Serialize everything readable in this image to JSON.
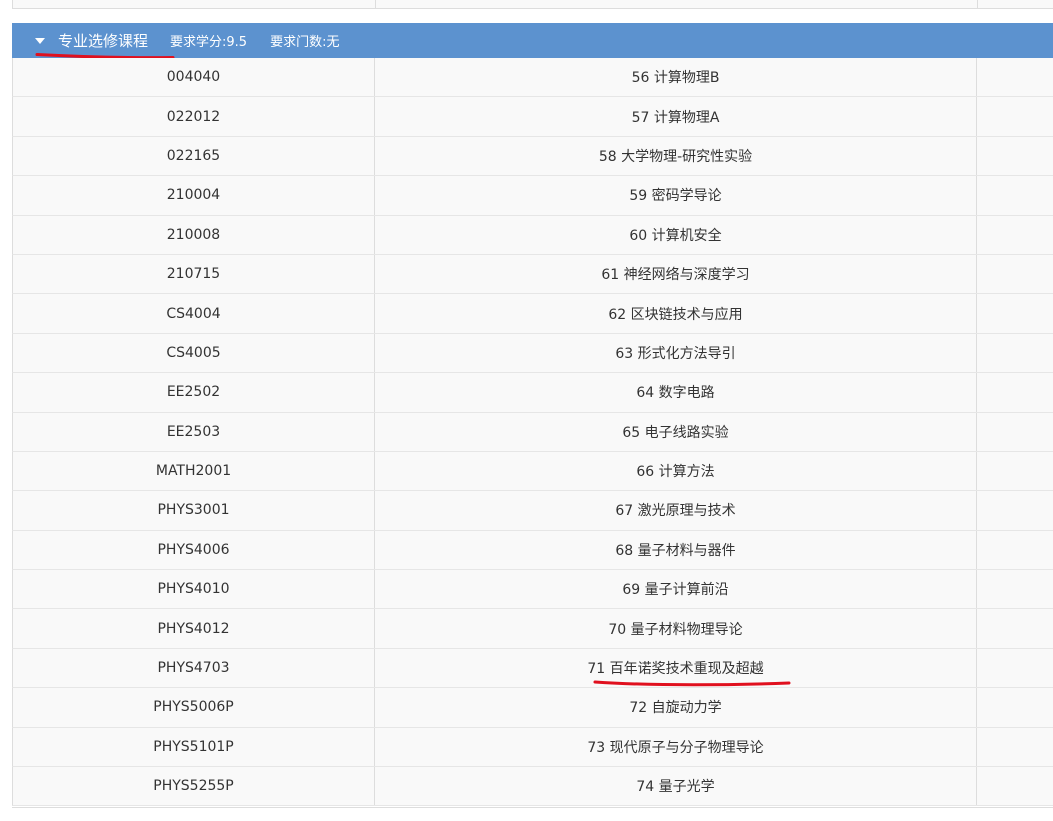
{
  "group": {
    "caret_icon": "caret-down-icon",
    "title": "专业选修课程",
    "required_credits": "要求学分:9.5",
    "required_courses": "要求门数:无"
  },
  "annotation_color": "#e0101e",
  "header_color": "#5c92cf",
  "courses": [
    {
      "code": "004040",
      "name": "56 计算物理B"
    },
    {
      "code": "022012",
      "name": "57 计算物理A"
    },
    {
      "code": "022165",
      "name": "58 大学物理-研究性实验"
    },
    {
      "code": "210004",
      "name": "59 密码学导论"
    },
    {
      "code": "210008",
      "name": "60 计算机安全"
    },
    {
      "code": "210715",
      "name": "61 神经网络与深度学习"
    },
    {
      "code": "CS4004",
      "name": "62 区块链技术与应用"
    },
    {
      "code": "CS4005",
      "name": "63 形式化方法导引"
    },
    {
      "code": "EE2502",
      "name": "64 数字电路"
    },
    {
      "code": "EE2503",
      "name": "65 电子线路实验"
    },
    {
      "code": "MATH2001",
      "name": "66 计算方法"
    },
    {
      "code": "PHYS3001",
      "name": "67 激光原理与技术"
    },
    {
      "code": "PHYS4006",
      "name": "68 量子材料与器件"
    },
    {
      "code": "PHYS4010",
      "name": "69 量子计算前沿"
    },
    {
      "code": "PHYS4012",
      "name": "70 量子材料物理导论"
    },
    {
      "code": "PHYS4703",
      "name": "71 百年诺奖技术重现及超越"
    },
    {
      "code": "PHYS5006P",
      "name": "72 自旋动力学"
    },
    {
      "code": "PHYS5101P",
      "name": "73 现代原子与分子物理导论"
    },
    {
      "code": "PHYS5255P",
      "name": "74 量子光学"
    }
  ]
}
